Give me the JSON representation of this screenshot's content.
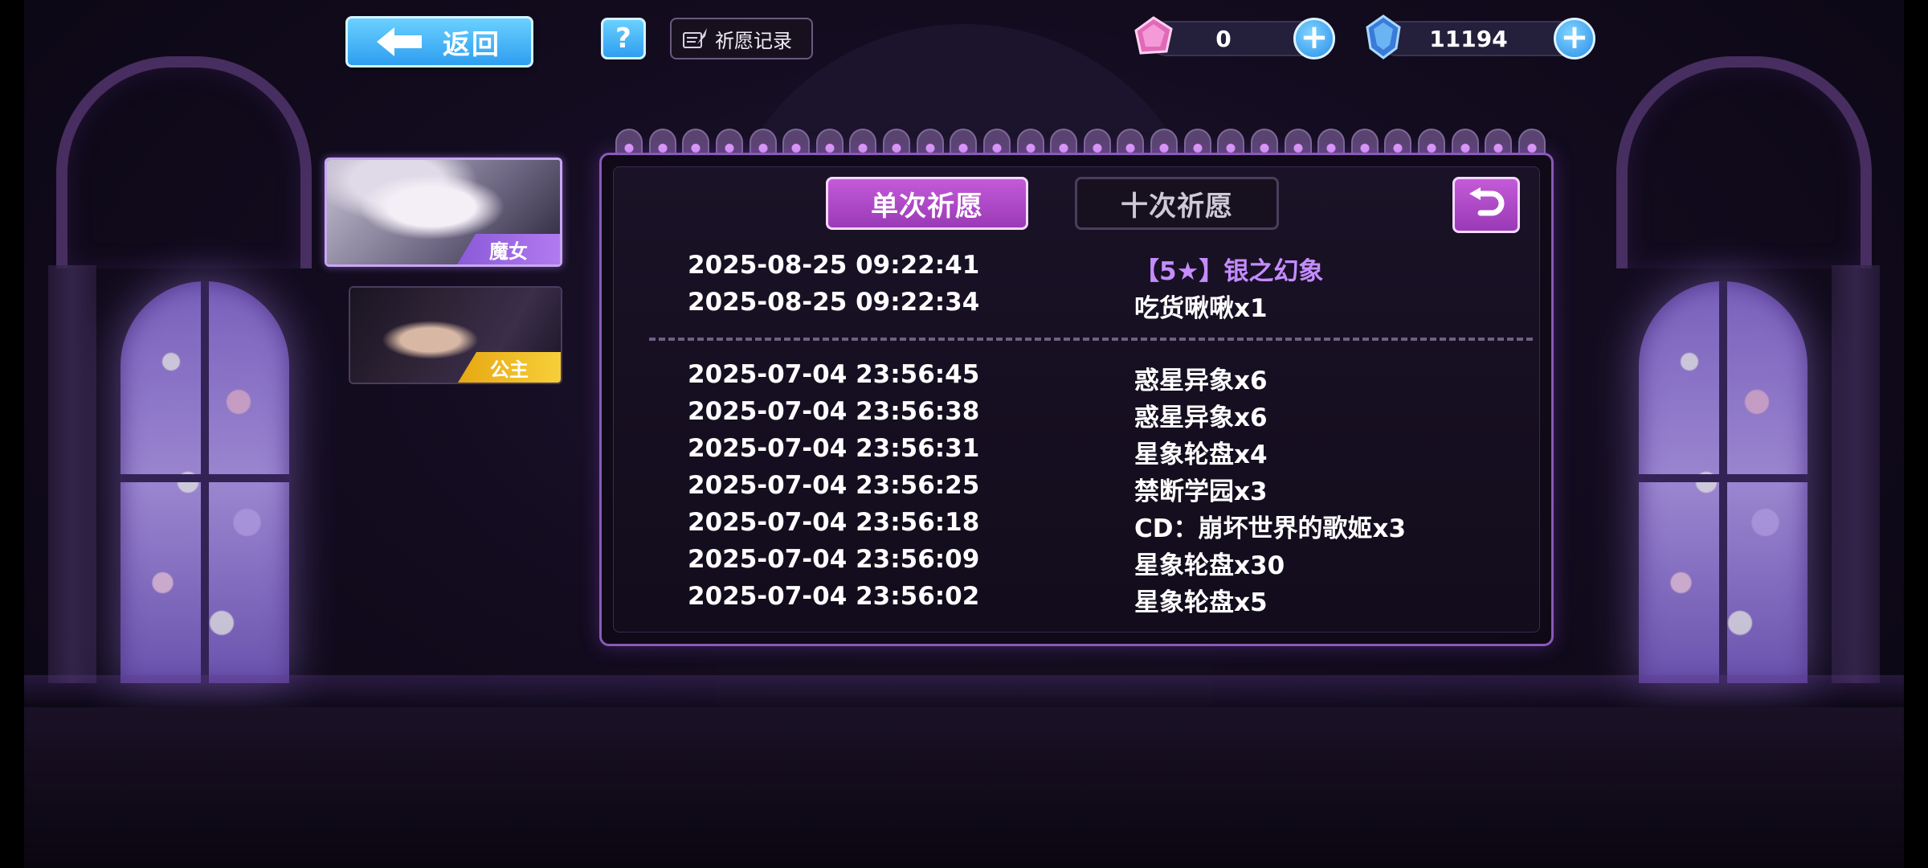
{
  "topbar": {
    "back_label": "返回",
    "help_label": "?",
    "history_label": "祈愿记录"
  },
  "currencies": [
    {
      "icon": "pink-crystal-icon",
      "value": "0"
    },
    {
      "icon": "blue-crystal-icon",
      "value": "11194"
    }
  ],
  "characters": [
    {
      "tag": "魔女",
      "selected": true
    },
    {
      "tag": "公主",
      "selected": false
    }
  ],
  "tabs": {
    "single": "单次祈愿",
    "ten": "十次祈愿"
  },
  "records_group1": [
    {
      "time": "2025-08-25 09:22:41",
      "item": "【5★】银之幻象",
      "highlight": true
    },
    {
      "time": "2025-08-25 09:22:34",
      "item": "吃货啾啾x1",
      "highlight": false
    }
  ],
  "records_group2": [
    {
      "time": "2025-07-04 23:56:45",
      "item": "惑星异象x6"
    },
    {
      "time": "2025-07-04 23:56:38",
      "item": "惑星异象x6"
    },
    {
      "time": "2025-07-04 23:56:31",
      "item": "星象轮盘x4"
    },
    {
      "time": "2025-07-04 23:56:25",
      "item": "禁断学园x3"
    },
    {
      "time": "2025-07-04 23:56:18",
      "item": "CD：崩坏世界的歌姬x3"
    },
    {
      "time": "2025-07-04 23:56:09",
      "item": "星象轮盘x30"
    },
    {
      "time": "2025-07-04 23:56:02",
      "item": "星象轮盘x5"
    }
  ],
  "colors": {
    "accent_purple": "#b04ad0",
    "button_blue": "#3aaaf2",
    "highlight_text": "#c48cff"
  }
}
